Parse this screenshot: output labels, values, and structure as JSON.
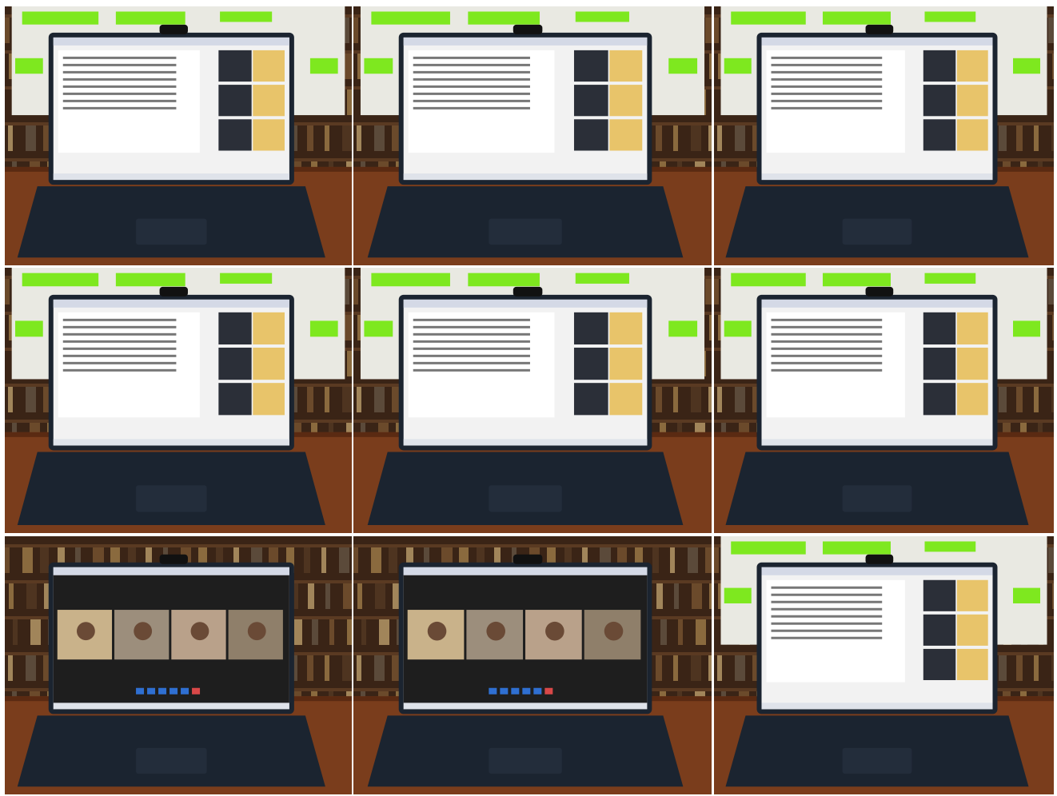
{
  "collage": {
    "rows": 3,
    "columns": 3,
    "background_color": "#ffffff",
    "tiles": [
      {
        "scene": "laptop-video-call-shared-document",
        "screen": "document",
        "monitor": "highlighted-pages",
        "row": 1,
        "column": 1
      },
      {
        "scene": "laptop-video-call-shared-document",
        "screen": "document",
        "monitor": "highlighted-pages",
        "row": 1,
        "column": 2
      },
      {
        "scene": "laptop-video-call-shared-document",
        "screen": "document",
        "monitor": "highlighted-pages",
        "row": 1,
        "column": 3
      },
      {
        "scene": "laptop-video-call-shared-document",
        "screen": "document",
        "monitor": "highlighted-pages",
        "row": 2,
        "column": 1
      },
      {
        "scene": "laptop-video-call-shared-document",
        "screen": "document",
        "monitor": "highlighted-pages",
        "row": 2,
        "column": 2
      },
      {
        "scene": "laptop-video-call-shared-document",
        "screen": "document",
        "monitor": "highlighted-pages",
        "row": 2,
        "column": 3
      },
      {
        "scene": "laptop-video-call-gallery",
        "screen": "gallery",
        "monitor": "none",
        "row": 3,
        "column": 1
      },
      {
        "scene": "laptop-video-call-gallery",
        "screen": "gallery",
        "monitor": "none",
        "row": 3,
        "column": 2
      },
      {
        "scene": "laptop-video-call-shared-document",
        "screen": "document",
        "monitor": "highlighted-pages",
        "row": 3,
        "column": 3
      }
    ]
  },
  "colors": {
    "highlight_green": "#7ee81f",
    "desk_wood": "#7a3d1c",
    "bookshelf": "#3a2416",
    "laptop_body": "#1b2430",
    "screen_light": "#f2f2f2",
    "video_panel": "#2b2f38"
  }
}
